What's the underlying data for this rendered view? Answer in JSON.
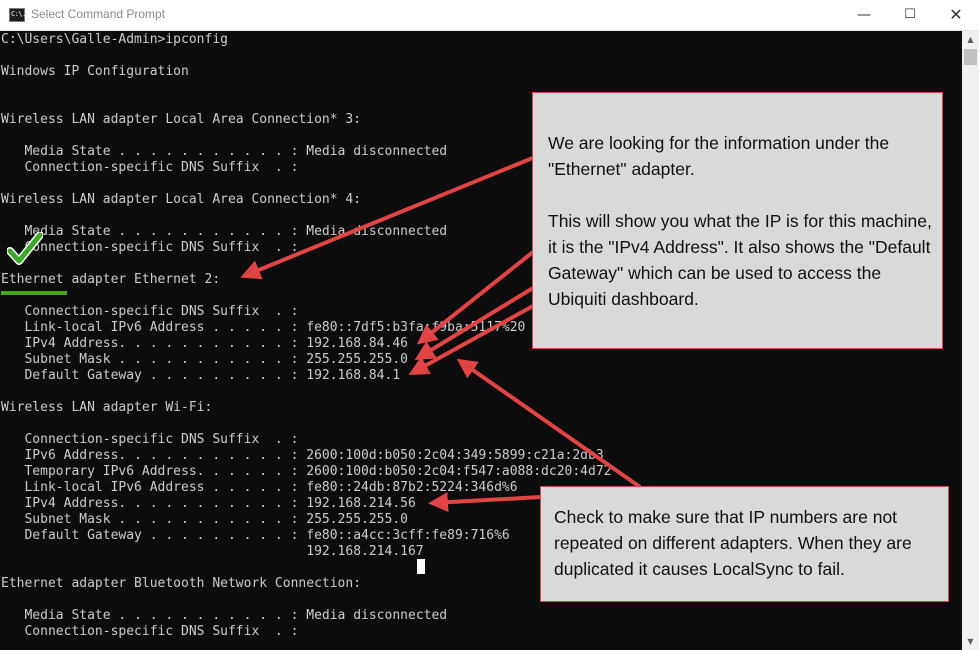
{
  "window": {
    "title": "Select Command Prompt",
    "icon_text": "C:\\.",
    "controls": {
      "minimize": "—",
      "maximize": "☐",
      "close": "✕"
    }
  },
  "console": {
    "lines": [
      "C:\\Users\\Galle-Admin>ipconfig",
      "",
      "Windows IP Configuration",
      "",
      "",
      "Wireless LAN adapter Local Area Connection* 3:",
      "",
      "   Media State . . . . . . . . . . . : Media disconnected",
      "   Connection-specific DNS Suffix  . :",
      "",
      "Wireless LAN adapter Local Area Connection* 4:",
      "",
      "   Media State . . . . . . . . . . . : Media disconnected",
      "   Connection-specific DNS Suffix  . :",
      "",
      "Ethernet adapter Ethernet 2:",
      "",
      "   Connection-specific DNS Suffix  . :",
      "   Link-local IPv6 Address . . . . . : fe80::7df5:b3fa:f9ba:5117%20",
      "   IPv4 Address. . . . . . . . . . . : 192.168.84.46",
      "   Subnet Mask . . . . . . . . . . . : 255.255.255.0",
      "   Default Gateway . . . . . . . . . : 192.168.84.1",
      "",
      "Wireless LAN adapter Wi-Fi:",
      "",
      "   Connection-specific DNS Suffix  . :",
      "   IPv6 Address. . . . . . . . . . . : 2600:100d:b050:2c04:349:5899:c21a:2db3",
      "   Temporary IPv6 Address. . . . . . : 2600:100d:b050:2c04:f547:a088:dc20:4d72",
      "   Link-local IPv6 Address . . . . . : fe80::24db:87b2:5224:346d%6",
      "   IPv4 Address. . . . . . . . . . . : 192.168.214.56",
      "   Subnet Mask . . . . . . . . . . . : 255.255.255.0",
      "   Default Gateway . . . . . . . . . : fe80::a4cc:3cff:fe89:716%6",
      "                                       192.168.214.167",
      "",
      "Ethernet adapter Bluetooth Network Connection:",
      "",
      "   Media State . . . . . . . . . . . : Media disconnected",
      "   Connection-specific DNS Suffix  . :"
    ]
  },
  "annotations": {
    "top_callout": {
      "paragraph_1": "We are looking for the information under the \"Ethernet\" adapter.",
      "paragraph_2": "This will show you what the IP is for this machine, it is the \"IPv4 Address\". It also shows the \"Default Gateway\" which can be used to access the Ubiquiti dashboard."
    },
    "bottom_callout": {
      "text": "Check to make sure that IP numbers are not repeated on different adapters. When they are duplicated it causes LocalSync to fail."
    },
    "check_icon": "checkmark-icon",
    "colors": {
      "arrow": "#e04444",
      "callout_border": "#d84a4a",
      "callout_fill": "#d9d9d9",
      "underline": "#44a81a",
      "check": "#3da82a",
      "console_bg": "#0c0c0c",
      "console_text": "#cccccc"
    }
  }
}
